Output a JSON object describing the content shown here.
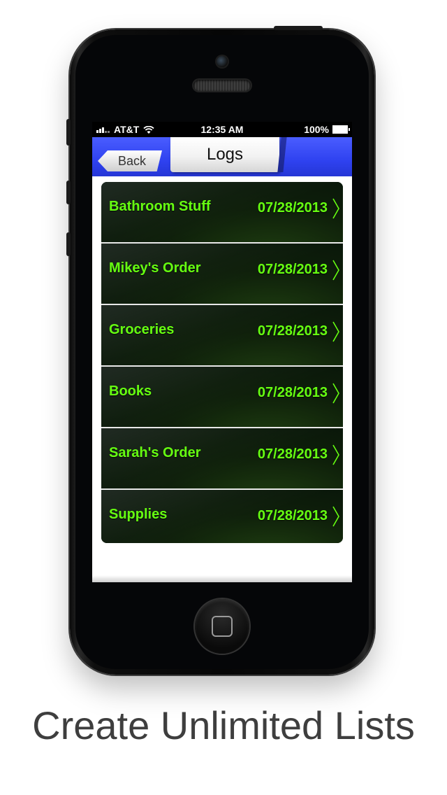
{
  "status_bar": {
    "carrier": "AT&T",
    "time": "12:35 AM",
    "battery": "100%"
  },
  "nav": {
    "back_label": "Back",
    "title": "Logs"
  },
  "logs": [
    {
      "name": "Bathroom Stuff",
      "date": "07/28/2013"
    },
    {
      "name": "Mikey's Order",
      "date": "07/28/2013"
    },
    {
      "name": "Groceries",
      "date": "07/28/2013"
    },
    {
      "name": "Books",
      "date": "07/28/2013"
    },
    {
      "name": "Sarah's Order",
      "date": "07/28/2013"
    },
    {
      "name": "Supplies",
      "date": "07/28/2013"
    }
  ],
  "caption": "Create Unlimited Lists",
  "colors": {
    "accent_green": "#66ff11",
    "nav_blue": "#2f42f0"
  }
}
